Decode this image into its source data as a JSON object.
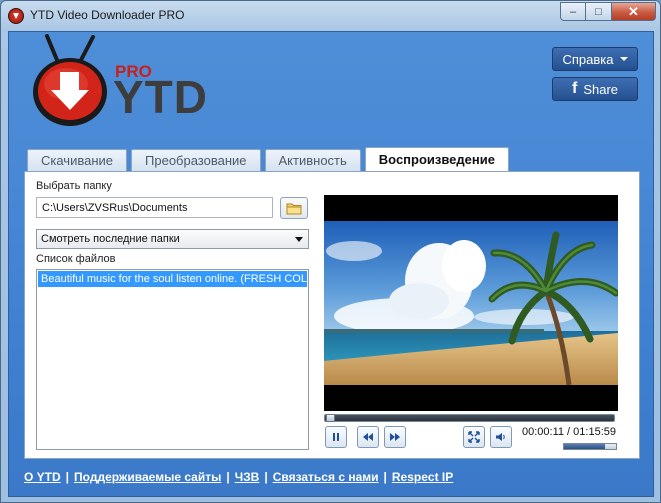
{
  "window": {
    "title": "YTD Video Downloader PRO",
    "min_label": "–",
    "max_label": "□",
    "close_label": "✕"
  },
  "logo": {
    "pro": "PRO",
    "name": "YTD"
  },
  "header": {
    "help_label": "Справка",
    "share_label": "Share",
    "share_brand": "f"
  },
  "tabs": [
    {
      "label": "Скачивание",
      "active": false
    },
    {
      "label": "Преобразование",
      "active": false
    },
    {
      "label": "Активность",
      "active": false
    },
    {
      "label": "Воспроизведение",
      "active": true
    }
  ],
  "playback": {
    "folder_label": "Выбрать папку",
    "folder_value": "C:\\Users\\ZVSRus\\Documents",
    "recent_select": "Смотреть последние папки",
    "file_list_label": "Список файлов",
    "files": [
      "Beautiful music for the soul listen online. (FRESH COLLECTION)"
    ]
  },
  "player": {
    "elapsed": "00:00:11",
    "total": "01:15:59",
    "time_display": "00:00:11 / 01:15:59",
    "progress_fraction": 0.003,
    "volume_fraction": 0.78
  },
  "footer": {
    "links": [
      "О YTD",
      "Поддерживаемые сайты",
      "ЧЗВ",
      "Связаться с нами",
      "Respect IP"
    ]
  },
  "colors": {
    "accent": "#3f7fd0",
    "selection": "#3399ff",
    "brand_red": "#c8201a"
  }
}
